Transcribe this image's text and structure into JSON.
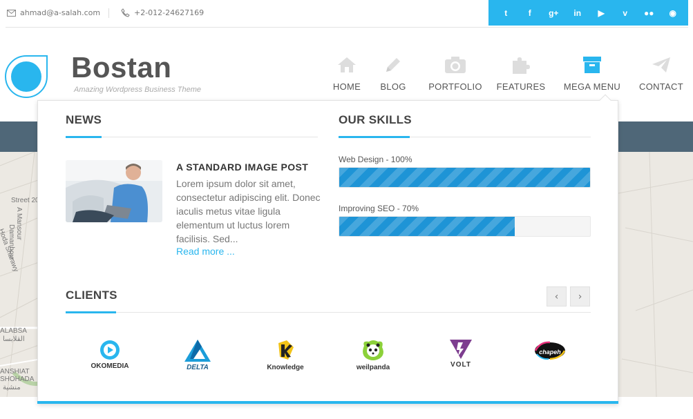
{
  "topbar": {
    "email": "ahmad@a-salah.com",
    "phone": "+2-012-24627169",
    "social_icons": [
      "twitter-icon",
      "facebook-icon",
      "google-plus-icon",
      "linkedin-icon",
      "youtube-icon",
      "vimeo-icon",
      "flickr-icon",
      "rss-icon"
    ],
    "social_glyphs": [
      "t",
      "f",
      "g+",
      "in",
      "▶",
      "v",
      "●●",
      "◉"
    ],
    "accent": "#29b6ee"
  },
  "brand": {
    "name": "Bostan",
    "tagline": "Amazing Wordpress Business Theme"
  },
  "nav": {
    "items": [
      {
        "label": "HOME",
        "icon": "home-icon"
      },
      {
        "label": "BLOG",
        "icon": "pencil-icon"
      },
      {
        "label": "PORTFOLIO",
        "icon": "camera-icon"
      },
      {
        "label": "FEATURES",
        "icon": "puzzle-icon"
      },
      {
        "label": "MEGA MENU",
        "icon": "archive-icon",
        "active": true
      },
      {
        "label": "CONTACT",
        "icon": "paper-plane-icon"
      }
    ]
  },
  "mega_menu": {
    "news": {
      "heading": "NEWS",
      "post_title": "A STANDARD IMAGE POST",
      "post_excerpt": "Lorem ipsum dolor sit amet, consectetur adipiscing elit. Donec iaculis metus vitae ligula elementum ut luctus lorem facilisis. Sed...",
      "read_more": "Read more ..."
    },
    "skills": {
      "heading": "OUR SKILLS",
      "items": [
        {
          "label": "Web Design - 100%",
          "percent": 100
        },
        {
          "label": "Improving SEO - 70%",
          "percent": 70
        }
      ]
    },
    "clients": {
      "heading": "CLIENTS",
      "prev": "‹",
      "next": "›",
      "logos": [
        "OKOMEDIA",
        "DELTA",
        "Knowledge",
        "weilpanda",
        "VOLT",
        "chapeh"
      ]
    }
  },
  "map": {
    "labels": [
      "Street 20",
      "A Mansour",
      "Damanhour",
      "Hoda Sharawy",
      "ALABSA",
      "القلابسا",
      "ANSHIAT",
      "SHOHADA",
      "منشية"
    ]
  }
}
